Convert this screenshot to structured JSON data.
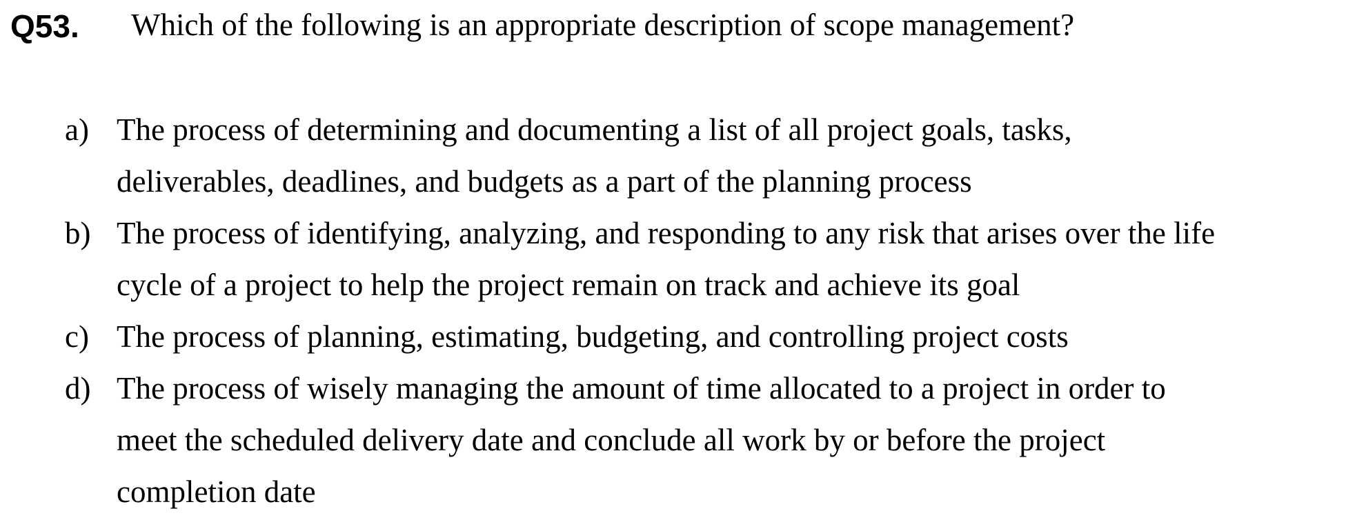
{
  "question": {
    "number": "Q53.",
    "text": "Which of the following is an appropriate description of scope management?"
  },
  "options": [
    {
      "label": "a)",
      "lines": [
        "The process of determining and documenting a list of all project goals, tasks,",
        "deliverables, deadlines, and budgets as a part of the planning process"
      ]
    },
    {
      "label": "b)",
      "lines": [
        "The process of identifying, analyzing, and responding to any risk that arises over the life",
        "cycle of a project to help the project remain on track and achieve its goal"
      ]
    },
    {
      "label": "c)",
      "lines": [
        "The process of planning, estimating, budgeting, and controlling project costs"
      ]
    },
    {
      "label": "d)",
      "lines": [
        "The process of wisely managing the amount of time allocated to a project in order to",
        "meet the scheduled delivery date and conclude all work by or before the project",
        "completion date"
      ]
    }
  ]
}
